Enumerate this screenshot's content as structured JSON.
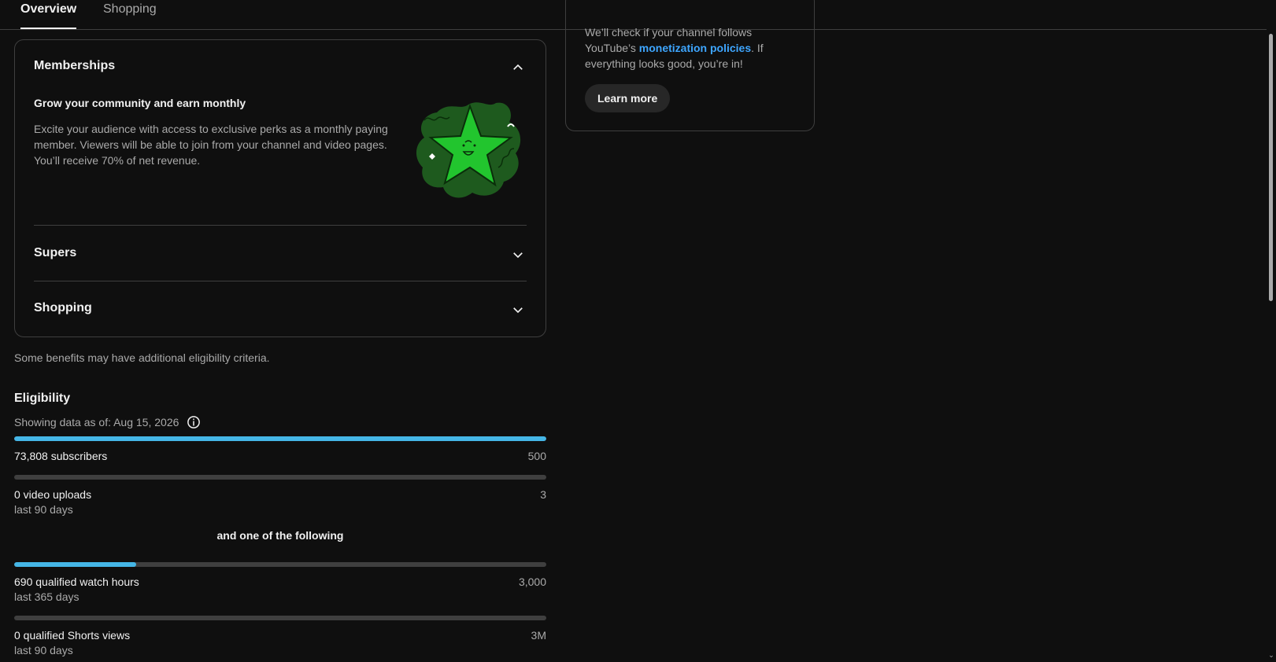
{
  "tabs": [
    {
      "label": "Overview",
      "active": true
    },
    {
      "label": "Shopping",
      "active": false
    }
  ],
  "memberships": {
    "title": "Memberships",
    "heading": "Grow your community and earn monthly",
    "description": "Excite your audience with access to exclusive perks as a monthly paying member. Viewers will be able to join from your channel and video pages. You’ll receive 70% of net revenue.",
    "illustration": "green-star-icon"
  },
  "supers": {
    "title": "Supers"
  },
  "shopping": {
    "title": "Shopping"
  },
  "note": "Some benefits may have additional eligibility criteria.",
  "eligibility": {
    "title": "Eligibility",
    "as_of": "Showing data as of: Aug 15, 2026",
    "metrics": [
      {
        "label": "73,808 subscribers",
        "sub": "",
        "target": "500",
        "progress": 1.0
      },
      {
        "label": "0 video uploads",
        "sub": "last 90 days",
        "target": "3",
        "progress": 0.0
      }
    ],
    "or_text": "and one of the following",
    "alt_metrics": [
      {
        "label": "690 qualified watch hours",
        "sub": "last 365 days",
        "target": "3,000",
        "progress": 0.23
      },
      {
        "label": "0 qualified Shorts views",
        "sub": "last 90 days",
        "target": "3M",
        "progress": 0.0
      }
    ]
  },
  "policy_card": {
    "text_before": "We’ll check if your channel follows YouTube’s ",
    "link": "monetization policies",
    "text_after": ". If everything looks good, you’re in!",
    "button": "Learn more"
  },
  "colors": {
    "progress": "#45b6e6",
    "link": "#3ea6ff",
    "background": "#0f0f0f"
  }
}
